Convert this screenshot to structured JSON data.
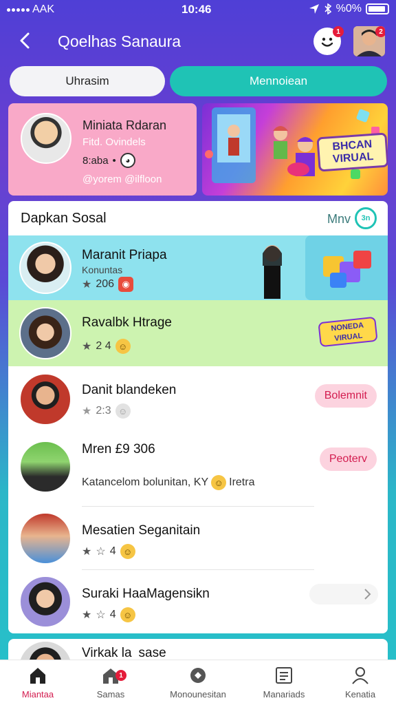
{
  "status_bar": {
    "carrier": "AAK",
    "time": "10:46",
    "battery": "%0%"
  },
  "header": {
    "title": "Qoelhas Sanaura",
    "notif_count": "1",
    "avatar_badge": "2"
  },
  "tabs": [
    {
      "label": "Uhrasim"
    },
    {
      "label": "Mennoiean"
    }
  ],
  "profile_card": {
    "name": "Miniata Rdaran",
    "subtitle": "Fitd. Ovindels",
    "count": "8:aba",
    "handle": "@yorem @ilfloon"
  },
  "banner": {
    "text": "BHCAN VIRUAL"
  },
  "panel": {
    "title": "Dapkan Sosal",
    "more_label": "Mnv",
    "more_icon_text": "3n"
  },
  "rows": [
    {
      "name": "Maranit Priapa",
      "sub": "Konuntas",
      "rating": "206"
    },
    {
      "name": "Ravalbk Htrage",
      "rating": "2 4",
      "badge_text": "NONEDA VIRUAL"
    },
    {
      "name": "Danit blandeken",
      "rating": "2:3",
      "action": "Bolemnit"
    },
    {
      "name": "Mren £9 306",
      "desc": "Katancelom bolunitan, KY",
      "desc_tail": "Iretra",
      "action": "Peoterv"
    },
    {
      "name": "Mesatien Seganitain",
      "rating": "4"
    },
    {
      "name": "Suraki HaaMagensikn",
      "rating": "4"
    }
  ],
  "partial_row": {
    "name": "Virkak la",
    "tail": "sase"
  },
  "bottom_nav": [
    {
      "label": "Miantaa",
      "icon": "home-icon",
      "active": true
    },
    {
      "label": "Samas",
      "icon": "store-icon",
      "badge": "1"
    },
    {
      "label": "Monounesitan",
      "icon": "tag-icon"
    },
    {
      "label": "Manariads",
      "icon": "document-icon"
    },
    {
      "label": "Kenatia",
      "icon": "user-icon"
    }
  ],
  "colors": {
    "accent_teal": "#1fc3b5",
    "accent_red": "#d31c4f",
    "card_pink": "#f9a9c8",
    "row_cyan": "#8ee2ee",
    "row_green": "#cdf3b0"
  }
}
